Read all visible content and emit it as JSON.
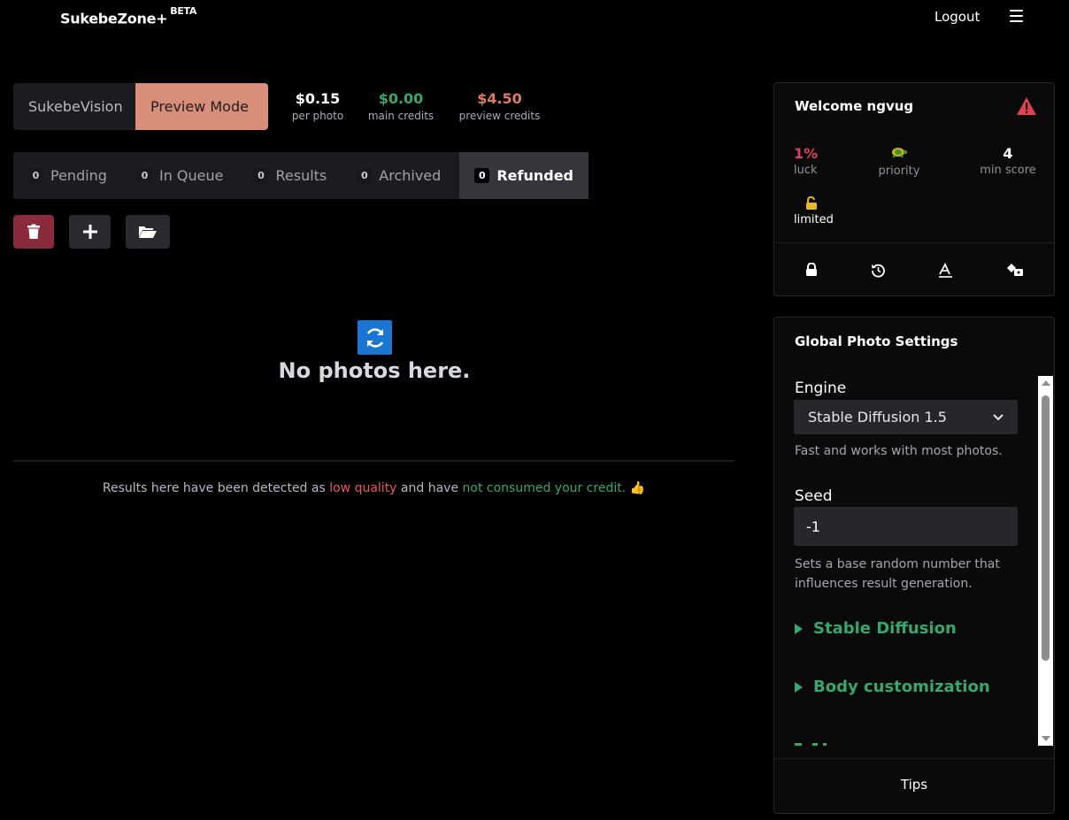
{
  "header": {
    "brand": "SukebeZone+",
    "brand_badge": "BETA",
    "logout_label": "Logout"
  },
  "modes": {
    "vision_label": "SukebeVision",
    "preview_label": "Preview Mode"
  },
  "stats": [
    {
      "value": "$0.15",
      "label": "per photo",
      "color": "#ffffff"
    },
    {
      "value": "$0.00",
      "label": "main credits",
      "color": "#37a86b"
    },
    {
      "value": "$4.50",
      "label": "preview credits",
      "color": "#e07a5f"
    }
  ],
  "tabs": [
    {
      "count": "0",
      "label": "Pending"
    },
    {
      "count": "0",
      "label": "In Queue"
    },
    {
      "count": "0",
      "label": "Results"
    },
    {
      "count": "0",
      "label": "Archived"
    },
    {
      "count": "0",
      "label": "Refunded",
      "active": true
    }
  ],
  "actions": {
    "delete_icon": "trash-icon",
    "add_icon": "plus-icon",
    "folder_icon": "folder-open-icon"
  },
  "empty_state": {
    "icon": "refresh-icon",
    "text": "No photos here."
  },
  "note": {
    "part1": "Results here have been detected as ",
    "low_quality": "low quality",
    "part2": " and have ",
    "not_consumed": "not consumed your credit.",
    "emoji": "👍"
  },
  "welcome": {
    "title": "Welcome ngvug",
    "luck_value": "1%",
    "luck_label": "luck",
    "priority_label": "priority",
    "min_score_value": "4",
    "min_score_label": "min score",
    "limited_label": "limited",
    "icons": [
      "lock-icon",
      "history-icon",
      "text-style-icon",
      "switch-icon"
    ]
  },
  "settings": {
    "title": "Global Photo Settings",
    "engine_label": "Engine",
    "engine_value": "Stable Diffusion 1.5",
    "engine_help": "Fast and works with most photos.",
    "seed_label": "Seed",
    "seed_value": "-1",
    "seed_help": "Sets a base random number that influences result generation.",
    "sections": [
      "Stable Diffusion",
      "Body customization"
    ],
    "tips_label": "Tips"
  }
}
